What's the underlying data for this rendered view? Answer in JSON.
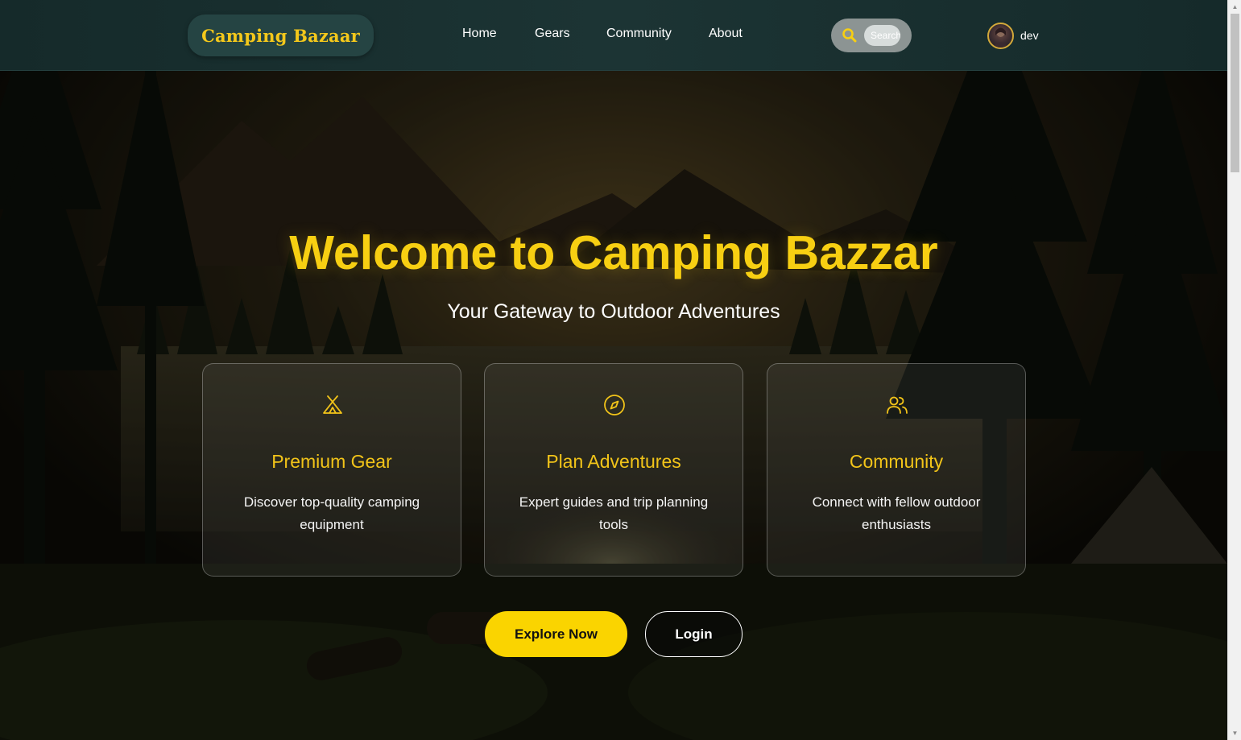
{
  "navbar": {
    "brand": "Camping Bazaar",
    "links": [
      {
        "label": "Home"
      },
      {
        "label": "Gears"
      },
      {
        "label": "Community"
      },
      {
        "label": "About"
      }
    ],
    "search": {
      "placeholder": "Search",
      "icon": "search-icon"
    },
    "user": {
      "name": "dev",
      "avatar": "avatar"
    }
  },
  "hero": {
    "title": "Welcome to Camping Bazzar",
    "subtitle": "Your Gateway to Outdoor Adventures"
  },
  "features": [
    {
      "icon": "tent-icon",
      "title": "Premium Gear",
      "description": "Discover top-quality camping equipment"
    },
    {
      "icon": "compass-icon",
      "title": "Plan Adventures",
      "description": "Expert guides and trip planning tools"
    },
    {
      "icon": "users-icon",
      "title": "Community",
      "description": "Connect with fellow outdoor enthusiasts"
    }
  ],
  "actions": {
    "primary": "Explore Now",
    "secondary": "Login"
  },
  "colors": {
    "accent": "#fad400",
    "navbar_bg": "#1c3434",
    "brand_pill": "#254443"
  }
}
